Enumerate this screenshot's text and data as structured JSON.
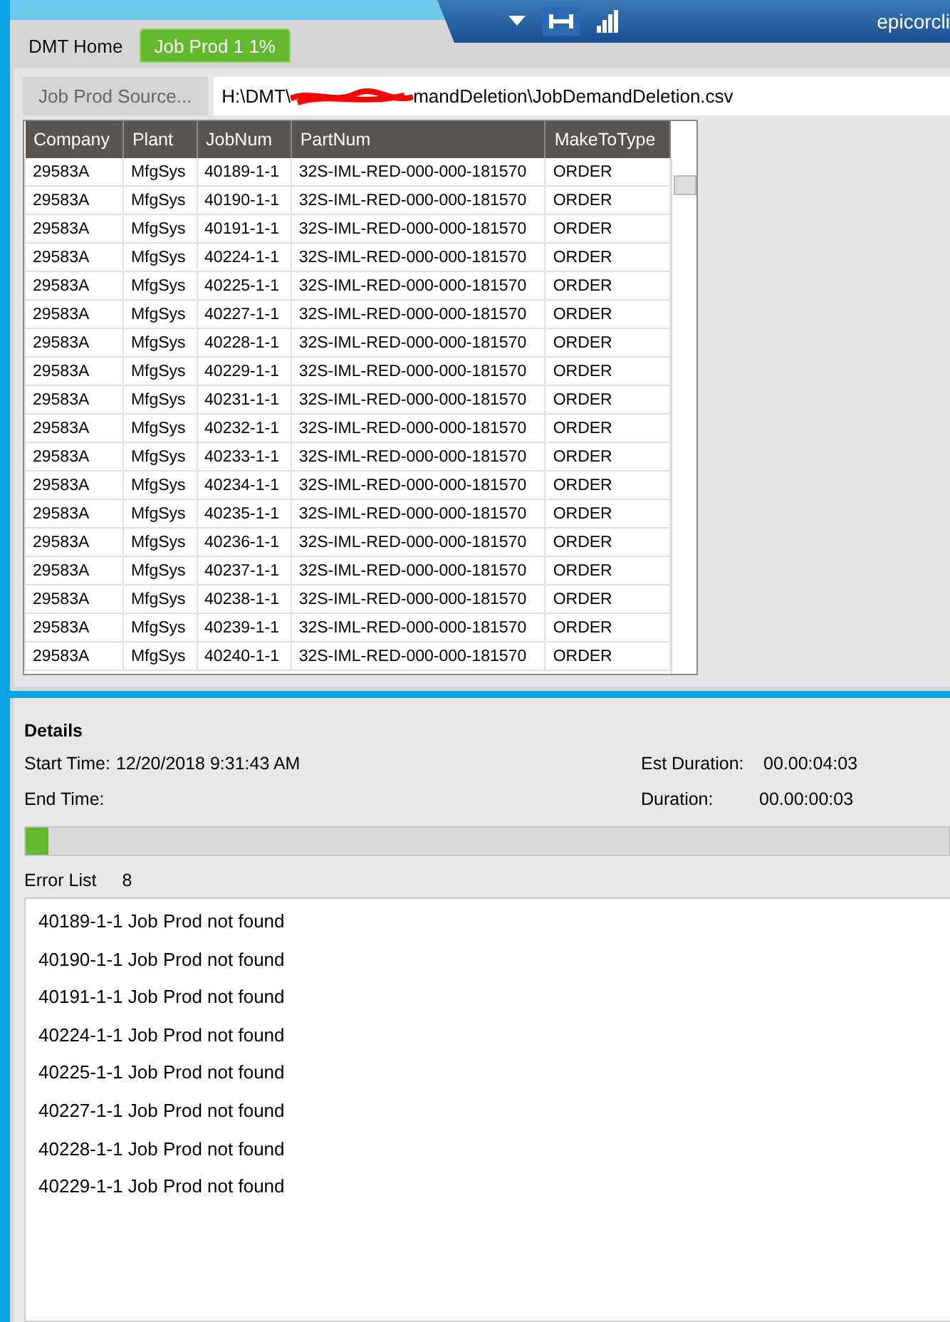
{
  "header": {
    "user": "epicorcli"
  },
  "tabs": [
    {
      "label": "DMT Home",
      "selected": false
    },
    {
      "label": "Job Prod 1 1%",
      "selected": true
    }
  ],
  "source": {
    "button": "Job Prod Source...",
    "path_start": "H:\\DMT\\",
    "path_end": "mandDeletion\\JobDemandDeletion.csv"
  },
  "table": {
    "columns": [
      "Company",
      "Plant",
      "JobNum",
      "PartNum",
      "MakeToType"
    ],
    "rows": [
      [
        "29583A",
        "MfgSys",
        "40189-1-1",
        "32S-IML-RED-000-000-181570",
        "ORDER"
      ],
      [
        "29583A",
        "MfgSys",
        "40190-1-1",
        "32S-IML-RED-000-000-181570",
        "ORDER"
      ],
      [
        "29583A",
        "MfgSys",
        "40191-1-1",
        "32S-IML-RED-000-000-181570",
        "ORDER"
      ],
      [
        "29583A",
        "MfgSys",
        "40224-1-1",
        "32S-IML-RED-000-000-181570",
        "ORDER"
      ],
      [
        "29583A",
        "MfgSys",
        "40225-1-1",
        "32S-IML-RED-000-000-181570",
        "ORDER"
      ],
      [
        "29583A",
        "MfgSys",
        "40227-1-1",
        "32S-IML-RED-000-000-181570",
        "ORDER"
      ],
      [
        "29583A",
        "MfgSys",
        "40228-1-1",
        "32S-IML-RED-000-000-181570",
        "ORDER"
      ],
      [
        "29583A",
        "MfgSys",
        "40229-1-1",
        "32S-IML-RED-000-000-181570",
        "ORDER"
      ],
      [
        "29583A",
        "MfgSys",
        "40231-1-1",
        "32S-IML-RED-000-000-181570",
        "ORDER"
      ],
      [
        "29583A",
        "MfgSys",
        "40232-1-1",
        "32S-IML-RED-000-000-181570",
        "ORDER"
      ],
      [
        "29583A",
        "MfgSys",
        "40233-1-1",
        "32S-IML-RED-000-000-181570",
        "ORDER"
      ],
      [
        "29583A",
        "MfgSys",
        "40234-1-1",
        "32S-IML-RED-000-000-181570",
        "ORDER"
      ],
      [
        "29583A",
        "MfgSys",
        "40235-1-1",
        "32S-IML-RED-000-000-181570",
        "ORDER"
      ],
      [
        "29583A",
        "MfgSys",
        "40236-1-1",
        "32S-IML-RED-000-000-181570",
        "ORDER"
      ],
      [
        "29583A",
        "MfgSys",
        "40237-1-1",
        "32S-IML-RED-000-000-181570",
        "ORDER"
      ],
      [
        "29583A",
        "MfgSys",
        "40238-1-1",
        "32S-IML-RED-000-000-181570",
        "ORDER"
      ],
      [
        "29583A",
        "MfgSys",
        "40239-1-1",
        "32S-IML-RED-000-000-181570",
        "ORDER"
      ],
      [
        "29583A",
        "MfgSys",
        "40240-1-1",
        "32S-IML-RED-000-000-181570",
        "ORDER"
      ]
    ]
  },
  "details": {
    "title": "Details",
    "start_label": "Start Time:",
    "start_value": "12/20/2018 9:31:43 AM",
    "est_label": "Est Duration:",
    "est_value": "00.00:04:03",
    "end_label": "End Time:",
    "duration_label": "Duration:",
    "duration_value": "00.00:00:03",
    "progress": {
      "level": 0.025
    },
    "error_label": "Error List",
    "error_count": "8"
  },
  "errors": [
    {
      "job": "40189-1-1",
      "message": "Job Prod not found"
    },
    {
      "job": "40190-1-1",
      "message": "Job Prod not found"
    },
    {
      "job": "40191-1-1",
      "message": "Job Prod not found"
    },
    {
      "job": "40224-1-1",
      "message": "Job Prod not found"
    },
    {
      "job": "40225-1-1",
      "message": "Job Prod not found"
    },
    {
      "job": "40227-1-1",
      "message": "Job Prod not found"
    },
    {
      "job": "40228-1-1",
      "message": "Job Prod not found"
    },
    {
      "job": "40229-1-1",
      "message": "Job Prod not found"
    }
  ]
}
